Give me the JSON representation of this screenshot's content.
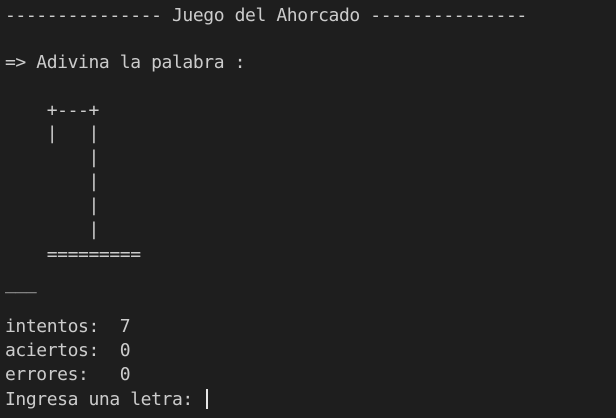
{
  "terminal": {
    "title_line": "--------------- Juego del Ahorcado ---------------",
    "prompt_line": "=> Adivina la palabra :",
    "hangman": {
      "top": "    +---+",
      "row1": "    |   |",
      "row2": "        |",
      "row3": "        |",
      "row4": "        |",
      "row5": "        |",
      "base": "    ========="
    },
    "word_blanks": "___",
    "stats": {
      "intentos": "intentos:  7",
      "aciertos": "aciertos:  0",
      "errores": "errores:   0"
    },
    "input_prompt": "Ingresa una letra: "
  },
  "colors": {
    "background": "#1e1e1e",
    "text": "#cccccc",
    "cursor": "#e6e6e6"
  }
}
